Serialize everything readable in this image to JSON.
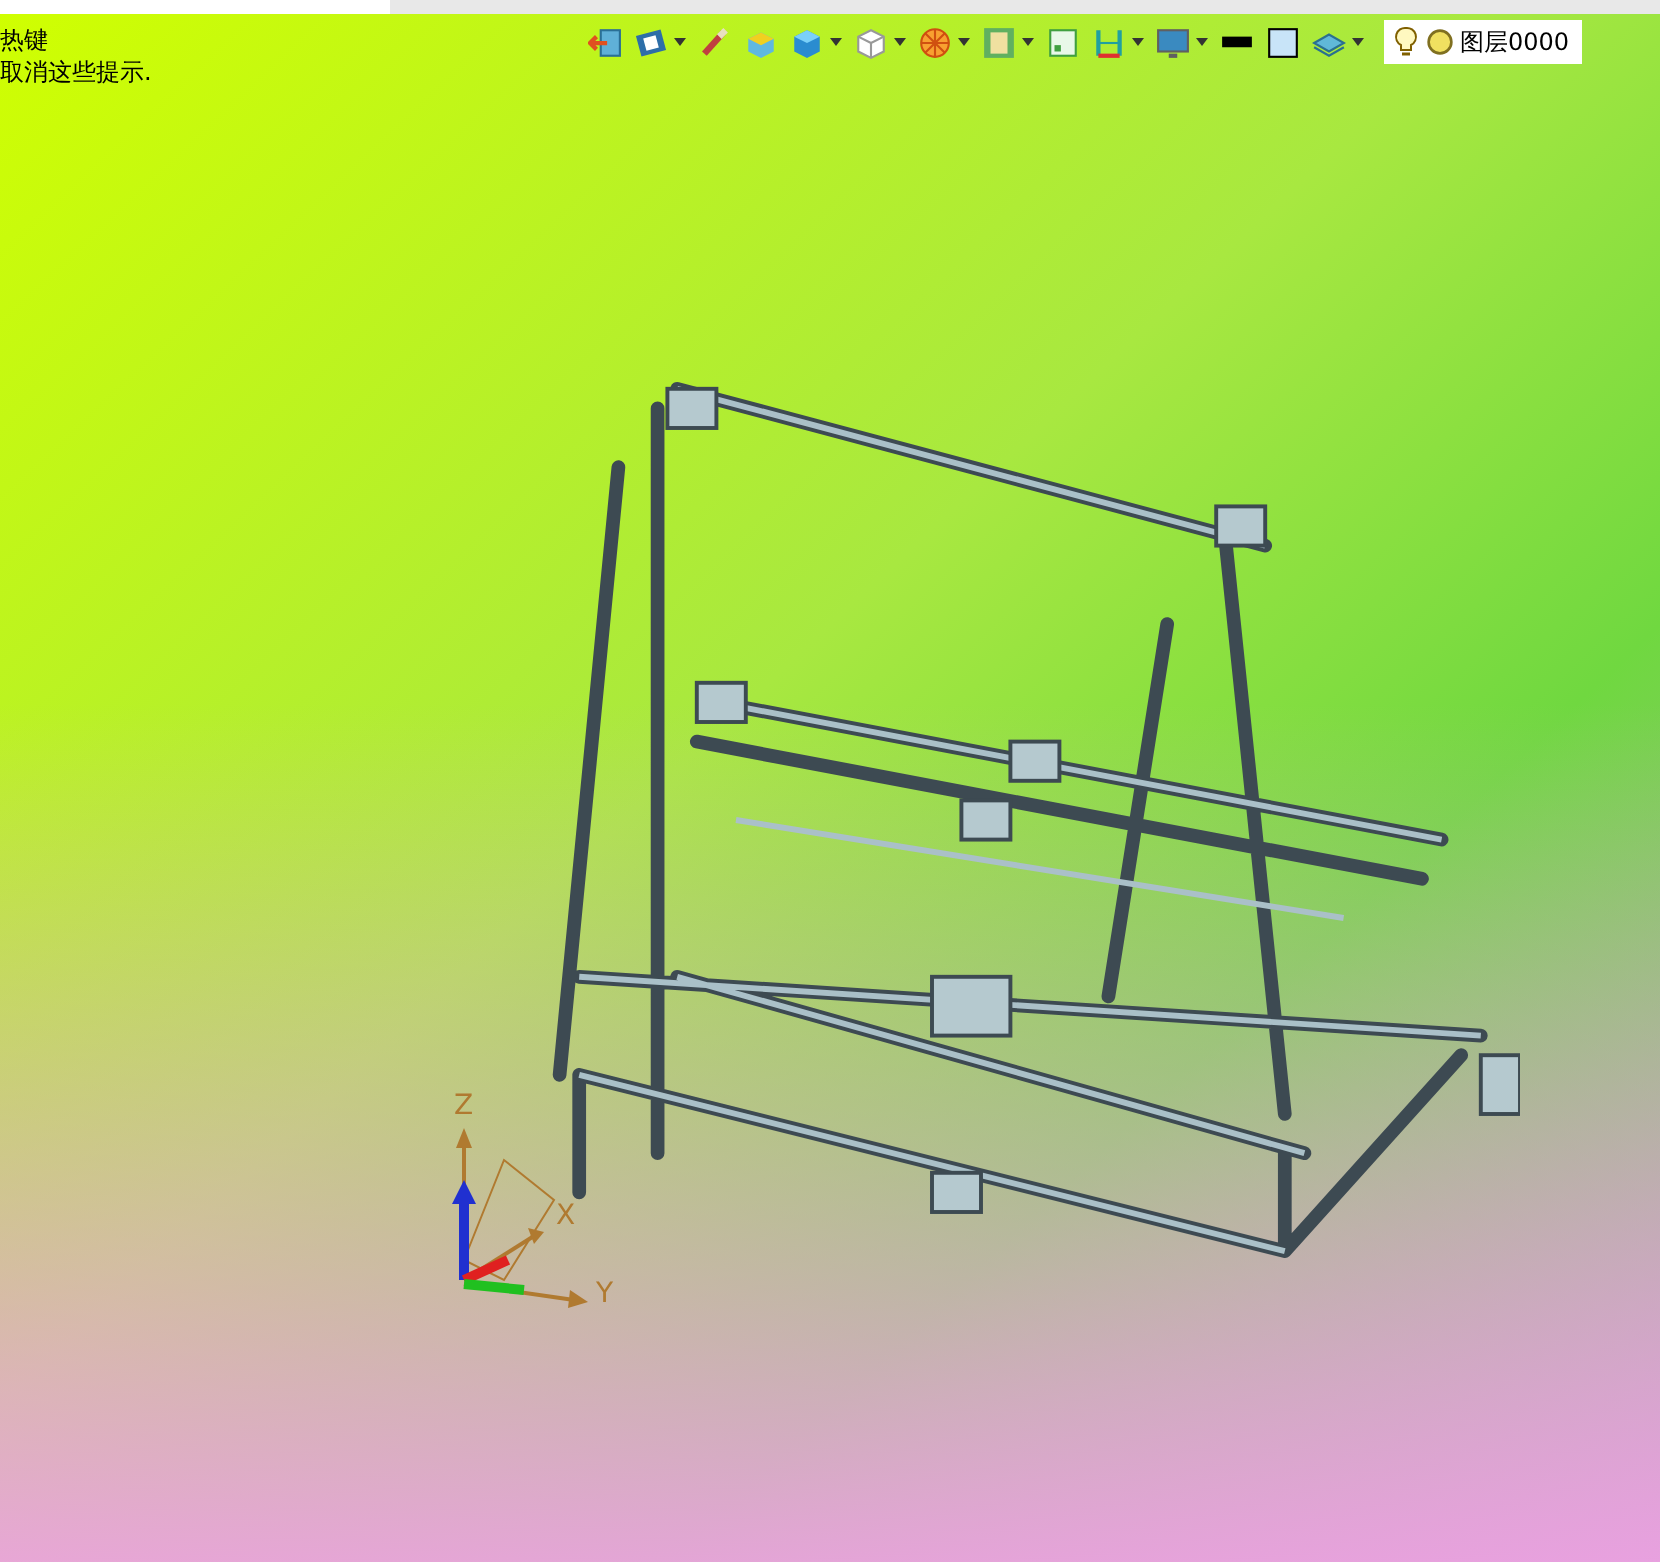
{
  "hints": [
    "热键",
    "取消这些提示."
  ],
  "toolbar": [
    {
      "kind": "exit",
      "dropdown": false
    },
    {
      "kind": "view",
      "dropdown": true
    },
    {
      "kind": "brush",
      "dropdown": false
    },
    {
      "kind": "box",
      "dropdown": false
    },
    {
      "kind": "cube",
      "dropdown": true
    },
    {
      "kind": "whitecube",
      "dropdown": true
    },
    {
      "kind": "wheel",
      "dropdown": true
    },
    {
      "kind": "frame",
      "dropdown": true
    },
    {
      "kind": "window",
      "dropdown": false
    },
    {
      "kind": "dimension",
      "dropdown": true
    },
    {
      "kind": "monitor",
      "dropdown": true
    },
    {
      "kind": "line",
      "dropdown": false
    },
    {
      "kind": "square",
      "dropdown": false
    },
    {
      "kind": "layers",
      "dropdown": true
    }
  ],
  "layer": {
    "label": "图层0000"
  },
  "axes": {
    "z": "Z",
    "x": "X",
    "y": "Y"
  }
}
